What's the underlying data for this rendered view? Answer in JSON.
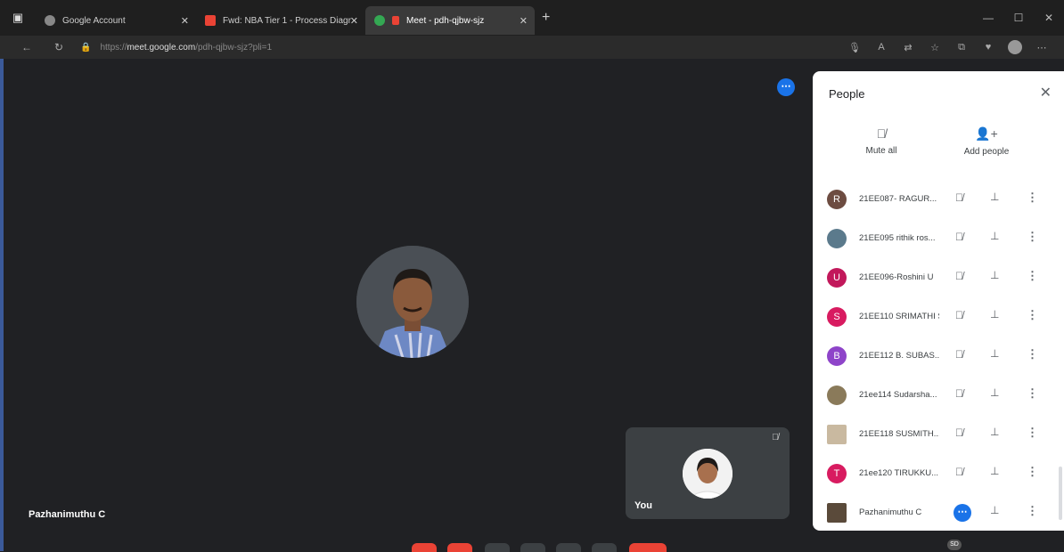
{
  "browser": {
    "tabs": [
      {
        "title": "Google Account",
        "icon": "google-account-icon",
        "active": false
      },
      {
        "title": "Fwd: NBA Tier 1 - Process Diagr",
        "icon": "gmail-icon",
        "active": false
      },
      {
        "title": "Meet - pdh-qjbw-sjz",
        "icon": "meet-icon",
        "active": true
      }
    ],
    "url_prefix": "https://",
    "url_host": "meet.google.com",
    "url_path": "/pdh-qjbw-sjz?pli=1"
  },
  "meeting": {
    "main_participant_name": "Pazhanimuthu C",
    "self_label": "You",
    "sd_badge": "SD"
  },
  "people_panel": {
    "title": "People",
    "mute_all_label": "Mute all",
    "add_people_label": "Add people",
    "participants": [
      {
        "initial": "R",
        "name": "21EE087- RAGUR...",
        "avatar_color": "#6d4c41"
      },
      {
        "initial": "",
        "name": "21EE095 rithik ros...",
        "avatar_color": "#5b7a8c"
      },
      {
        "initial": "U",
        "name": "21EE096-Roshini U",
        "avatar_color": "#c2185b"
      },
      {
        "initial": "S",
        "name": "21EE110 SRIMATHI S",
        "avatar_color": "#d81b60"
      },
      {
        "initial": "B",
        "name": "21EE112 B. SUBAS...",
        "avatar_color": "#8e44c9"
      },
      {
        "initial": "",
        "name": "21ee114 Sudarsha...",
        "avatar_color": "#8a7a5a"
      },
      {
        "initial": "",
        "name": "21EE118 SUSMITH...",
        "avatar_color": "#c9b9a0"
      },
      {
        "initial": "T",
        "name": "21ee120 TIRUKKU...",
        "avatar_color": "#d81b60"
      },
      {
        "initial": "",
        "name": "Pazhanimuthu C",
        "avatar_color": "#5a4a3a"
      }
    ]
  }
}
